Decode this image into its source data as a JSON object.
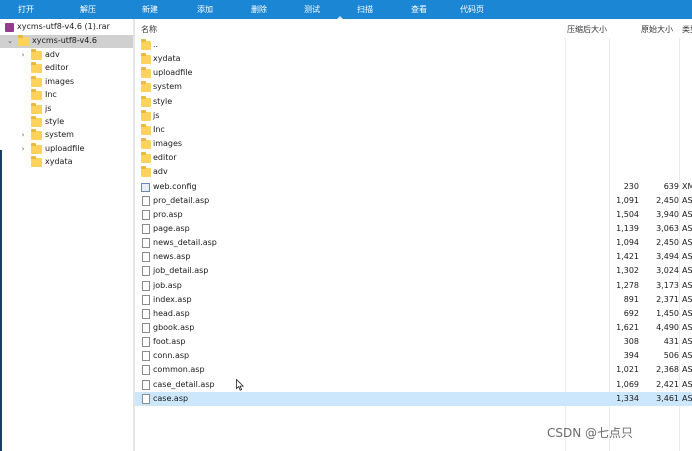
{
  "toolbar": {
    "items": [
      "打开",
      "解压",
      "新建",
      "添加",
      "删除",
      "测试",
      "扫描",
      "查看",
      "代码页"
    ]
  },
  "tree": {
    "root": "xycms-utf8-v4.6 (1).rar",
    "folder": "xycms-utf8-v4.6",
    "children": [
      "adv",
      "editor",
      "images",
      "Inc",
      "js",
      "style",
      "system",
      "uploadfile",
      "xydata"
    ],
    "expandable": [
      "adv",
      "system",
      "uploadfile"
    ]
  },
  "list": {
    "columns": {
      "name": "名称",
      "packed": "压缩后大小",
      "original": "原始大小",
      "type": "类型"
    },
    "rows": [
      {
        "name": "..",
        "kind": "folder",
        "packed": "",
        "orig": "",
        "type": ""
      },
      {
        "name": "xydata",
        "kind": "folder",
        "packed": "",
        "orig": "",
        "type": ""
      },
      {
        "name": "uploadfile",
        "kind": "folder",
        "packed": "",
        "orig": "",
        "type": ""
      },
      {
        "name": "system",
        "kind": "folder",
        "packed": "",
        "orig": "",
        "type": ""
      },
      {
        "name": "style",
        "kind": "folder",
        "packed": "",
        "orig": "",
        "type": ""
      },
      {
        "name": "js",
        "kind": "folder",
        "packed": "",
        "orig": "",
        "type": ""
      },
      {
        "name": "Inc",
        "kind": "folder",
        "packed": "",
        "orig": "",
        "type": ""
      },
      {
        "name": "images",
        "kind": "folder",
        "packed": "",
        "orig": "",
        "type": ""
      },
      {
        "name": "editor",
        "kind": "folder",
        "packed": "",
        "orig": "",
        "type": ""
      },
      {
        "name": "adv",
        "kind": "folder",
        "packed": "",
        "orig": "",
        "type": ""
      },
      {
        "name": "web.config",
        "kind": "config",
        "packed": "230",
        "orig": "639",
        "type": "XM"
      },
      {
        "name": "pro_detail.asp",
        "kind": "file",
        "packed": "1,091",
        "orig": "2,450",
        "type": "AS"
      },
      {
        "name": "pro.asp",
        "kind": "file",
        "packed": "1,504",
        "orig": "3,940",
        "type": "AS"
      },
      {
        "name": "page.asp",
        "kind": "file",
        "packed": "1,139",
        "orig": "3,063",
        "type": "AS"
      },
      {
        "name": "news_detail.asp",
        "kind": "file",
        "packed": "1,094",
        "orig": "2,450",
        "type": "AS"
      },
      {
        "name": "news.asp",
        "kind": "file",
        "packed": "1,421",
        "orig": "3,494",
        "type": "AS"
      },
      {
        "name": "job_detail.asp",
        "kind": "file",
        "packed": "1,302",
        "orig": "3,024",
        "type": "AS"
      },
      {
        "name": "job.asp",
        "kind": "file",
        "packed": "1,278",
        "orig": "3,173",
        "type": "AS"
      },
      {
        "name": "index.asp",
        "kind": "file",
        "packed": "891",
        "orig": "2,371",
        "type": "AS"
      },
      {
        "name": "head.asp",
        "kind": "file",
        "packed": "692",
        "orig": "1,450",
        "type": "AS"
      },
      {
        "name": "gbook.asp",
        "kind": "file",
        "packed": "1,621",
        "orig": "4,490",
        "type": "AS"
      },
      {
        "name": "foot.asp",
        "kind": "file",
        "packed": "308",
        "orig": "431",
        "type": "AS"
      },
      {
        "name": "conn.asp",
        "kind": "file",
        "packed": "394",
        "orig": "506",
        "type": "AS"
      },
      {
        "name": "common.asp",
        "kind": "file",
        "packed": "1,021",
        "orig": "2,368",
        "type": "AS"
      },
      {
        "name": "case_detail.asp",
        "kind": "file",
        "packed": "1,069",
        "orig": "2,421",
        "type": "AS"
      },
      {
        "name": "case.asp",
        "kind": "file",
        "packed": "1,334",
        "orig": "3,461",
        "type": "AS",
        "selected": true
      }
    ]
  },
  "watermark": "CSDN @七点只",
  "colors": {
    "toolbar": "#1b86d4",
    "folder": "#ffd25c",
    "selection": "#cce6fb"
  }
}
